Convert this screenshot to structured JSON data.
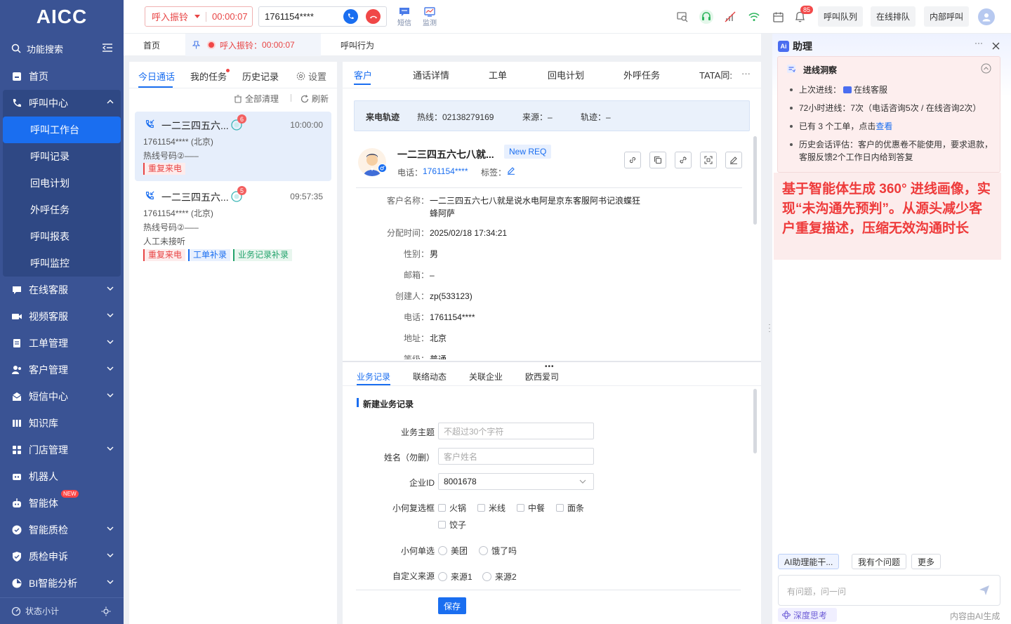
{
  "app": {
    "logo": "AICC"
  },
  "sidebar": {
    "search_label": "功能搜索",
    "items": [
      {
        "label": "首页",
        "icon": "home-icon"
      },
      {
        "label": "呼叫中心",
        "icon": "phone-icon",
        "expanded": true
      },
      {
        "label": "在线客服",
        "icon": "chat-icon"
      },
      {
        "label": "视频客服",
        "icon": "video-icon"
      },
      {
        "label": "工单管理",
        "icon": "ticket-icon"
      },
      {
        "label": "客户管理",
        "icon": "users-icon"
      },
      {
        "label": "短信中心",
        "icon": "sms-icon"
      },
      {
        "label": "知识库",
        "icon": "book-icon"
      },
      {
        "label": "门店管理",
        "icon": "grid-icon"
      },
      {
        "label": "机器人",
        "icon": "robot-icon"
      },
      {
        "label": "智能体",
        "icon": "agent-icon",
        "badge": "NEW"
      },
      {
        "label": "智能质检",
        "icon": "inspect-icon"
      },
      {
        "label": "质检申诉",
        "icon": "shield-icon"
      },
      {
        "label": "BI智能分析",
        "icon": "chart-icon"
      }
    ],
    "sub_items": [
      "呼叫工作台",
      "呼叫记录",
      "回电计划",
      "外呼任务",
      "呼叫报表",
      "呼叫监控"
    ],
    "footer_label": "状态小计"
  },
  "header": {
    "call_status": "呼入振铃",
    "call_timer": "00:00:07",
    "phone_number": "1761154****",
    "tools": [
      {
        "label": "短信",
        "icon": "sms-icon"
      },
      {
        "label": "监测",
        "icon": "monitor-icon"
      }
    ],
    "notification_count": "85",
    "buttons": [
      "呼叫队列",
      "在线排队",
      "内部呼叫"
    ]
  },
  "page_tabs": {
    "home": "首页",
    "ringing_label": "呼入振铃：",
    "ringing_timer": "00:00:07",
    "call_behavior": "呼叫行为"
  },
  "list_panel": {
    "tabs": [
      "今日通话",
      "我的任务",
      "历史记录"
    ],
    "settings": "设置",
    "clear_all": "全部清理",
    "refresh": "刷新",
    "cards": [
      {
        "name": "一二三四五六...",
        "badge": "6",
        "time": "10:00:00",
        "phone": "1761154**** (北京)",
        "hotline": "热线号码②–––",
        "status": "",
        "tags": [
          {
            "text": "重复来电",
            "color": "red"
          }
        ]
      },
      {
        "name": "一二三四五六...",
        "badge": "5",
        "time": "09:57:35",
        "phone": "1761154**** (北京)",
        "hotline": "热线号码②–––",
        "status": "人工未接听",
        "tags": [
          {
            "text": "重复来电",
            "color": "red"
          },
          {
            "text": "工单补录",
            "color": "blue"
          },
          {
            "text": "业务记录补录",
            "color": "green"
          }
        ]
      }
    ]
  },
  "center": {
    "tabs": [
      "客户",
      "通话详情",
      "工单",
      "回电计划",
      "外呼任务",
      "TATA同:"
    ],
    "more": "···",
    "trace": {
      "title": "来电轨迹",
      "hotline": "热线：02138279169",
      "source": "来源：–",
      "track": "轨迹：–"
    },
    "customer": {
      "name": "一二三四五六七八就...",
      "tag": "New REQ",
      "phone_label": "电话：",
      "phone": "1761154****",
      "tag_label": "标签："
    },
    "fields": [
      {
        "label": "客户名称：",
        "value": "一二三四五六七八就是说水电阿是京东客服阿书记浪蝶狂蜂阿萨"
      },
      {
        "label": "分配时间：",
        "value": "2025/02/18 17:34:21"
      },
      {
        "label": "性别：",
        "value": "男"
      },
      {
        "label": "邮箱：",
        "value": "–"
      },
      {
        "label": "创建人：",
        "value": "zp(533123)"
      },
      {
        "label": "电话：",
        "value": "1761154****"
      },
      {
        "label": "地址：",
        "value": "北京"
      },
      {
        "label": "等级：",
        "value": "普通"
      }
    ],
    "bottom_tabs": [
      "业务记录",
      "联络动态",
      "关联企业",
      "欧西爱司"
    ],
    "form": {
      "title": "新建业务记录",
      "subject_label": "业务主题",
      "subject_placeholder": "不超过30个字符",
      "name_label": "姓名（勿删）",
      "name_placeholder": "客户姓名",
      "company_label": "企业ID",
      "company_value": "8001678",
      "checkbox_label": "小何复选框",
      "checkbox_options": [
        "火锅",
        "米线",
        "中餐",
        "面条",
        "饺子"
      ],
      "radio_label": "小何单选",
      "radio_options": [
        "美团",
        "饿了吗"
      ],
      "source_label": "自定义来源",
      "source_options": [
        "来源1",
        "来源2"
      ],
      "save": "保存"
    }
  },
  "assistant": {
    "title": "助理",
    "insight_title": "进线洞察",
    "insights": [
      {
        "text": "上次进线：",
        "extra": "在线客服"
      },
      {
        "text": "72小时进线：7次（电话咨询5次 / 在线咨询2次）"
      },
      {
        "text": "已有 3 个工单，点击",
        "link": "查看"
      },
      {
        "text": "历史会话评估：客户的优惠卷不能使用，要求退款，客服反馈2个工作日内给到答复"
      }
    ],
    "note": "基于智能体生成 360° 进线画像，实现“未沟通先预判”。从源头减少客户重复描述，压缩无效沟通时长",
    "chips": [
      "AI助理能干...",
      "我有个问题",
      "更多"
    ],
    "input_placeholder": "有问题，问一问",
    "deep_think": "深度思考",
    "ai_generated": "内容由AI生成"
  }
}
